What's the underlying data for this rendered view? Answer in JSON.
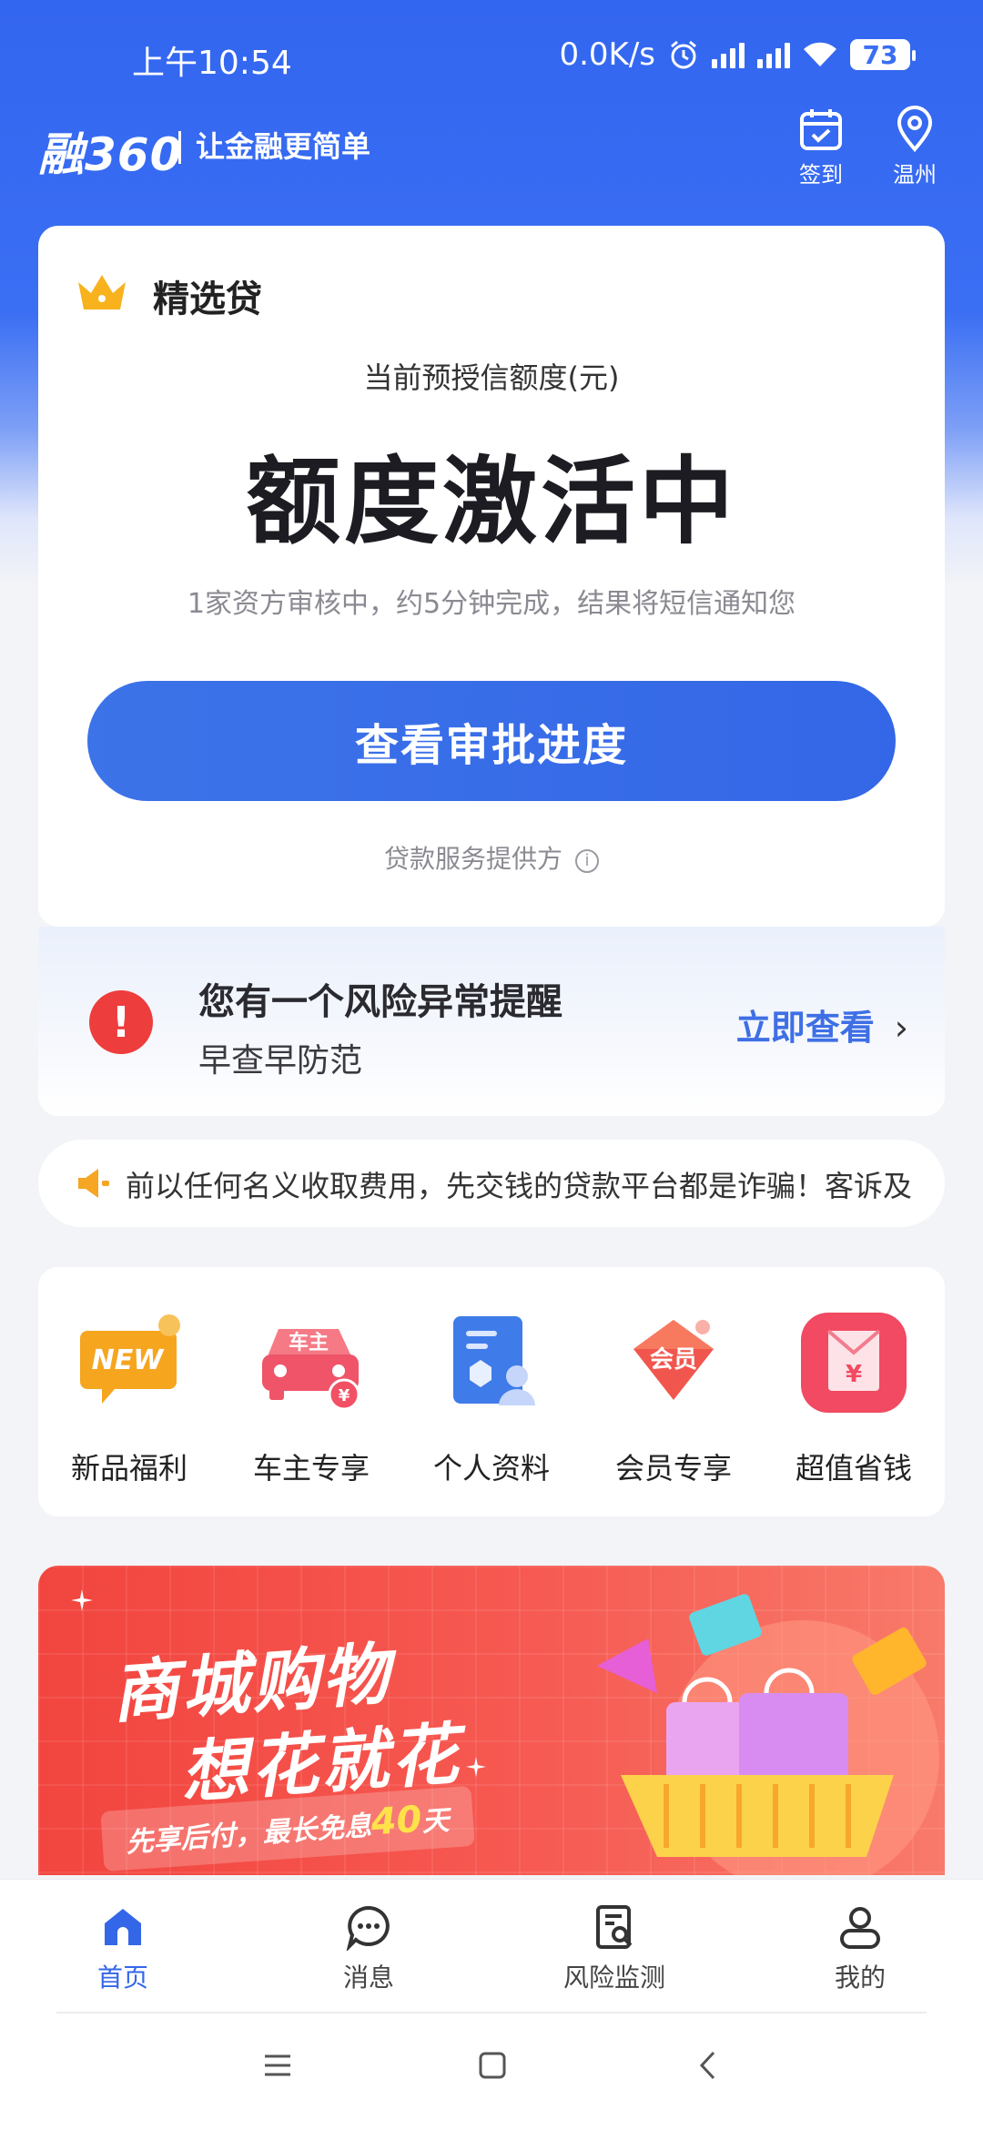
{
  "status_bar": {
    "time": "上午10:54",
    "net_speed": "0.0K/s",
    "battery": "73"
  },
  "header": {
    "logo": "融360",
    "slogan": "让金融更简单",
    "checkin_label": "签到",
    "location_label": "温州"
  },
  "loan_card": {
    "tag": "精选贷",
    "credit_label": "当前预授信额度(元)",
    "credit_status": "额度激活中",
    "description": "1家资方审核中，约5分钟完成，结果将短信通知您",
    "cta_label": "查看审批进度",
    "provider_label": "贷款服务提供方"
  },
  "risk_alert": {
    "title": "您有一个风险异常提醒",
    "subtitle": "早查早防范",
    "link_label": "立即查看"
  },
  "notice": {
    "text": "前以任何名义收取费用，先交钱的贷款平台都是诈骗！客诉及"
  },
  "services": [
    {
      "label": "新品福利",
      "icon": "new-icon",
      "icon_text": "NEW"
    },
    {
      "label": "车主专享",
      "icon": "car-icon",
      "icon_text": "车主"
    },
    {
      "label": "个人资料",
      "icon": "profile-doc-icon"
    },
    {
      "label": "会员专享",
      "icon": "member-icon",
      "icon_text": "会员"
    },
    {
      "label": "超值省钱",
      "icon": "savings-envelope-icon",
      "icon_text": "¥"
    }
  ],
  "banner": {
    "line1": "商城购物",
    "line2": "想花就花",
    "sub_prefix": "先享后付，最长免息",
    "sub_highlight": "40",
    "sub_suffix": "天"
  },
  "bottom_nav": [
    {
      "label": "首页",
      "icon": "home-icon",
      "active": true
    },
    {
      "label": "消息",
      "icon": "message-icon",
      "active": false
    },
    {
      "label": "风险监测",
      "icon": "risk-monitor-icon",
      "active": false
    },
    {
      "label": "我的",
      "icon": "profile-icon",
      "active": false
    }
  ],
  "colors": {
    "brand_blue": "#3467e7",
    "alert_red": "#ee3d3d",
    "banner_red": "#f2453f"
  }
}
